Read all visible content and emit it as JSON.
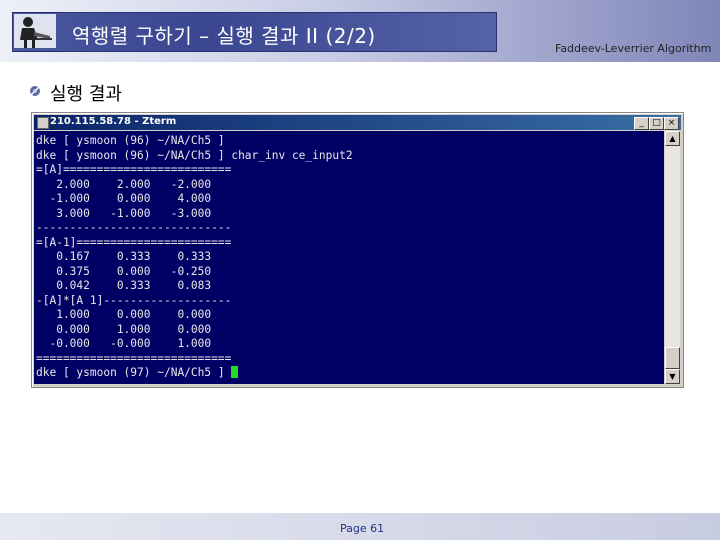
{
  "slide": {
    "title": "역행렬 구하기 – 실행 결과 II (2/2)",
    "subtitle": "Faddeev-Leverrier Algorithm",
    "heading": "실행 결과",
    "page_label": "Page 61"
  },
  "terminal": {
    "window_title": "210.115.58.78 - Zterm",
    "buttons": {
      "minimize": "_",
      "maximize": "□",
      "close": "×"
    },
    "lines": [
      "dke [ ysmoon (96) ~/NA/Ch5 ]",
      "dke [ ysmoon (96) ~/NA/Ch5 ] char_inv ce_input2",
      "=[A]=========================",
      "   2.000    2.000   -2.000",
      "  -1.000    0.000    4.000",
      "   3.000   -1.000   -3.000",
      "-----------------------------",
      "=[A-1]=======================",
      "   0.167    0.333    0.333",
      "   0.375    0.000   -0.250",
      "   0.042    0.333    0.083",
      "-[A]*[A 1]-------------------",
      "   1.000    0.000    0.000",
      "   0.000    1.000    0.000",
      "  -0.000   -0.000    1.000",
      "============================="
    ],
    "prompt": "dke [ ysmoon (97) ~/NA/Ch5 ] "
  },
  "colors": {
    "terminal_bg": "#000064",
    "terminal_fg": "#e8e8e8",
    "cursor": "#22dd22",
    "title_box": "#3a4690"
  }
}
